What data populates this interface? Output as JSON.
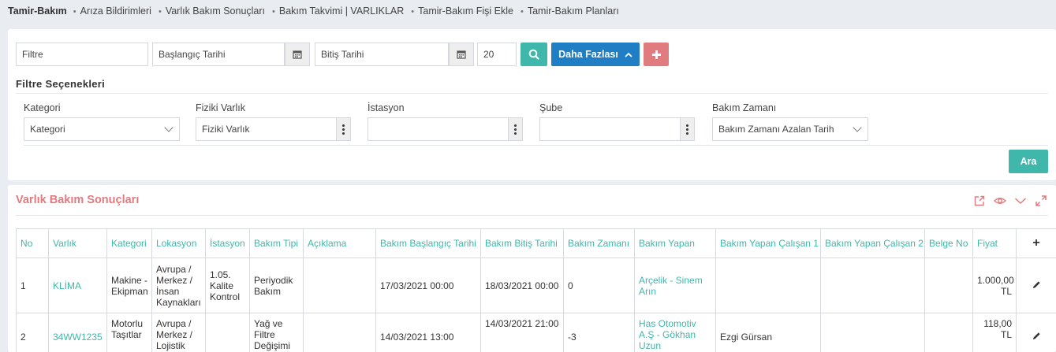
{
  "breadcrumb": {
    "current": "Tamir-Bakım",
    "items": [
      "Arıza Bildirimleri",
      "Varlık Bakım Sonuçları",
      "Bakım Takvimi | VARLIKLAR",
      "Tamir-Bakım Fişi Ekle",
      "Tamir-Bakım Planları"
    ]
  },
  "filter": {
    "filter_placeholder": "Filtre",
    "start_date_placeholder": "Başlangıç Tarihi",
    "end_date_placeholder": "Bitiş Tarihi",
    "page_size": "20",
    "more_label": "Daha Fazlası",
    "options_title": "Filtre Seçenekleri",
    "fields": {
      "kategori": {
        "label": "Kategori",
        "value": "Kategori"
      },
      "fiziki_varlik": {
        "label": "Fiziki Varlık",
        "value": "Fiziki Varlık"
      },
      "istasyon": {
        "label": "İstasyon",
        "value": ""
      },
      "sube": {
        "label": "Şube",
        "value": ""
      },
      "bakim_zamani": {
        "label": "Bakım Zamanı",
        "value": "Bakım Zamanı Azalan Tarih"
      }
    },
    "search_label": "Ara"
  },
  "results": {
    "title": "Varlık Bakım Sonuçları",
    "columns": [
      "No",
      "Varlık",
      "Kategori",
      "Lokasyon",
      "İstasyon",
      "Bakım Tipi",
      "Açıklama",
      "Bakım Başlangıç Tarihi",
      "Bakım Bitiş Tarihi",
      "Bakım Zamanı",
      "Bakım Yapan",
      "Bakım Yapan Çalışan 1",
      "Bakım Yapan Çalışan 2",
      "Belge No",
      "Fiyat"
    ],
    "rows": [
      {
        "no": "1",
        "varlik": "KLİMA",
        "kategori": "Makine - Ekipman",
        "lokasyon": "Avrupa / Merkez / İnsan Kaynakları",
        "istasyon": "1.05. Kalite Kontrol",
        "bakim_tipi": "Periyodik Bakım",
        "aciklama": "",
        "baslangic": "17/03/2021 00:00",
        "bitis": "18/03/2021 00:00",
        "zaman": "0",
        "yapan": "Arçelik - Sinem Arın",
        "calisan1": "",
        "calisan2": "",
        "belge": "",
        "fiyat": "1.000,00 TL"
      },
      {
        "no": "2",
        "varlik": "34WW1235",
        "kategori": "Motorlu Taşıtlar",
        "lokasyon": "Avrupa / Merkez / Lojistik",
        "istasyon": "",
        "bakim_tipi": "Yağ ve Filtre Değişimi",
        "aciklama": "",
        "baslangic": "14/03/2021 13:00",
        "bitis": "14/03/2021 21:00",
        "zaman": "-3",
        "yapan": "Has Otomotiv A.Ş - Gökhan Uzun",
        "calisan1": "Ezgi Gürsan",
        "calisan2": "",
        "belge": "",
        "fiyat": "118,00 TL"
      }
    ]
  },
  "colors": {
    "teal": "#3fb7ab",
    "blue": "#1f7ec4",
    "red": "#e07b7f"
  },
  "icons": {
    "calendar": "calendar-icon",
    "search": "search-icon",
    "chevron_up": "chevron-up-icon",
    "plus": "plus-icon",
    "kebab": "kebab-menu-icon",
    "export": "export-icon",
    "eye": "eye-icon",
    "collapse": "chevron-down-icon",
    "expand": "expand-icon",
    "edit": "pencil-icon"
  }
}
